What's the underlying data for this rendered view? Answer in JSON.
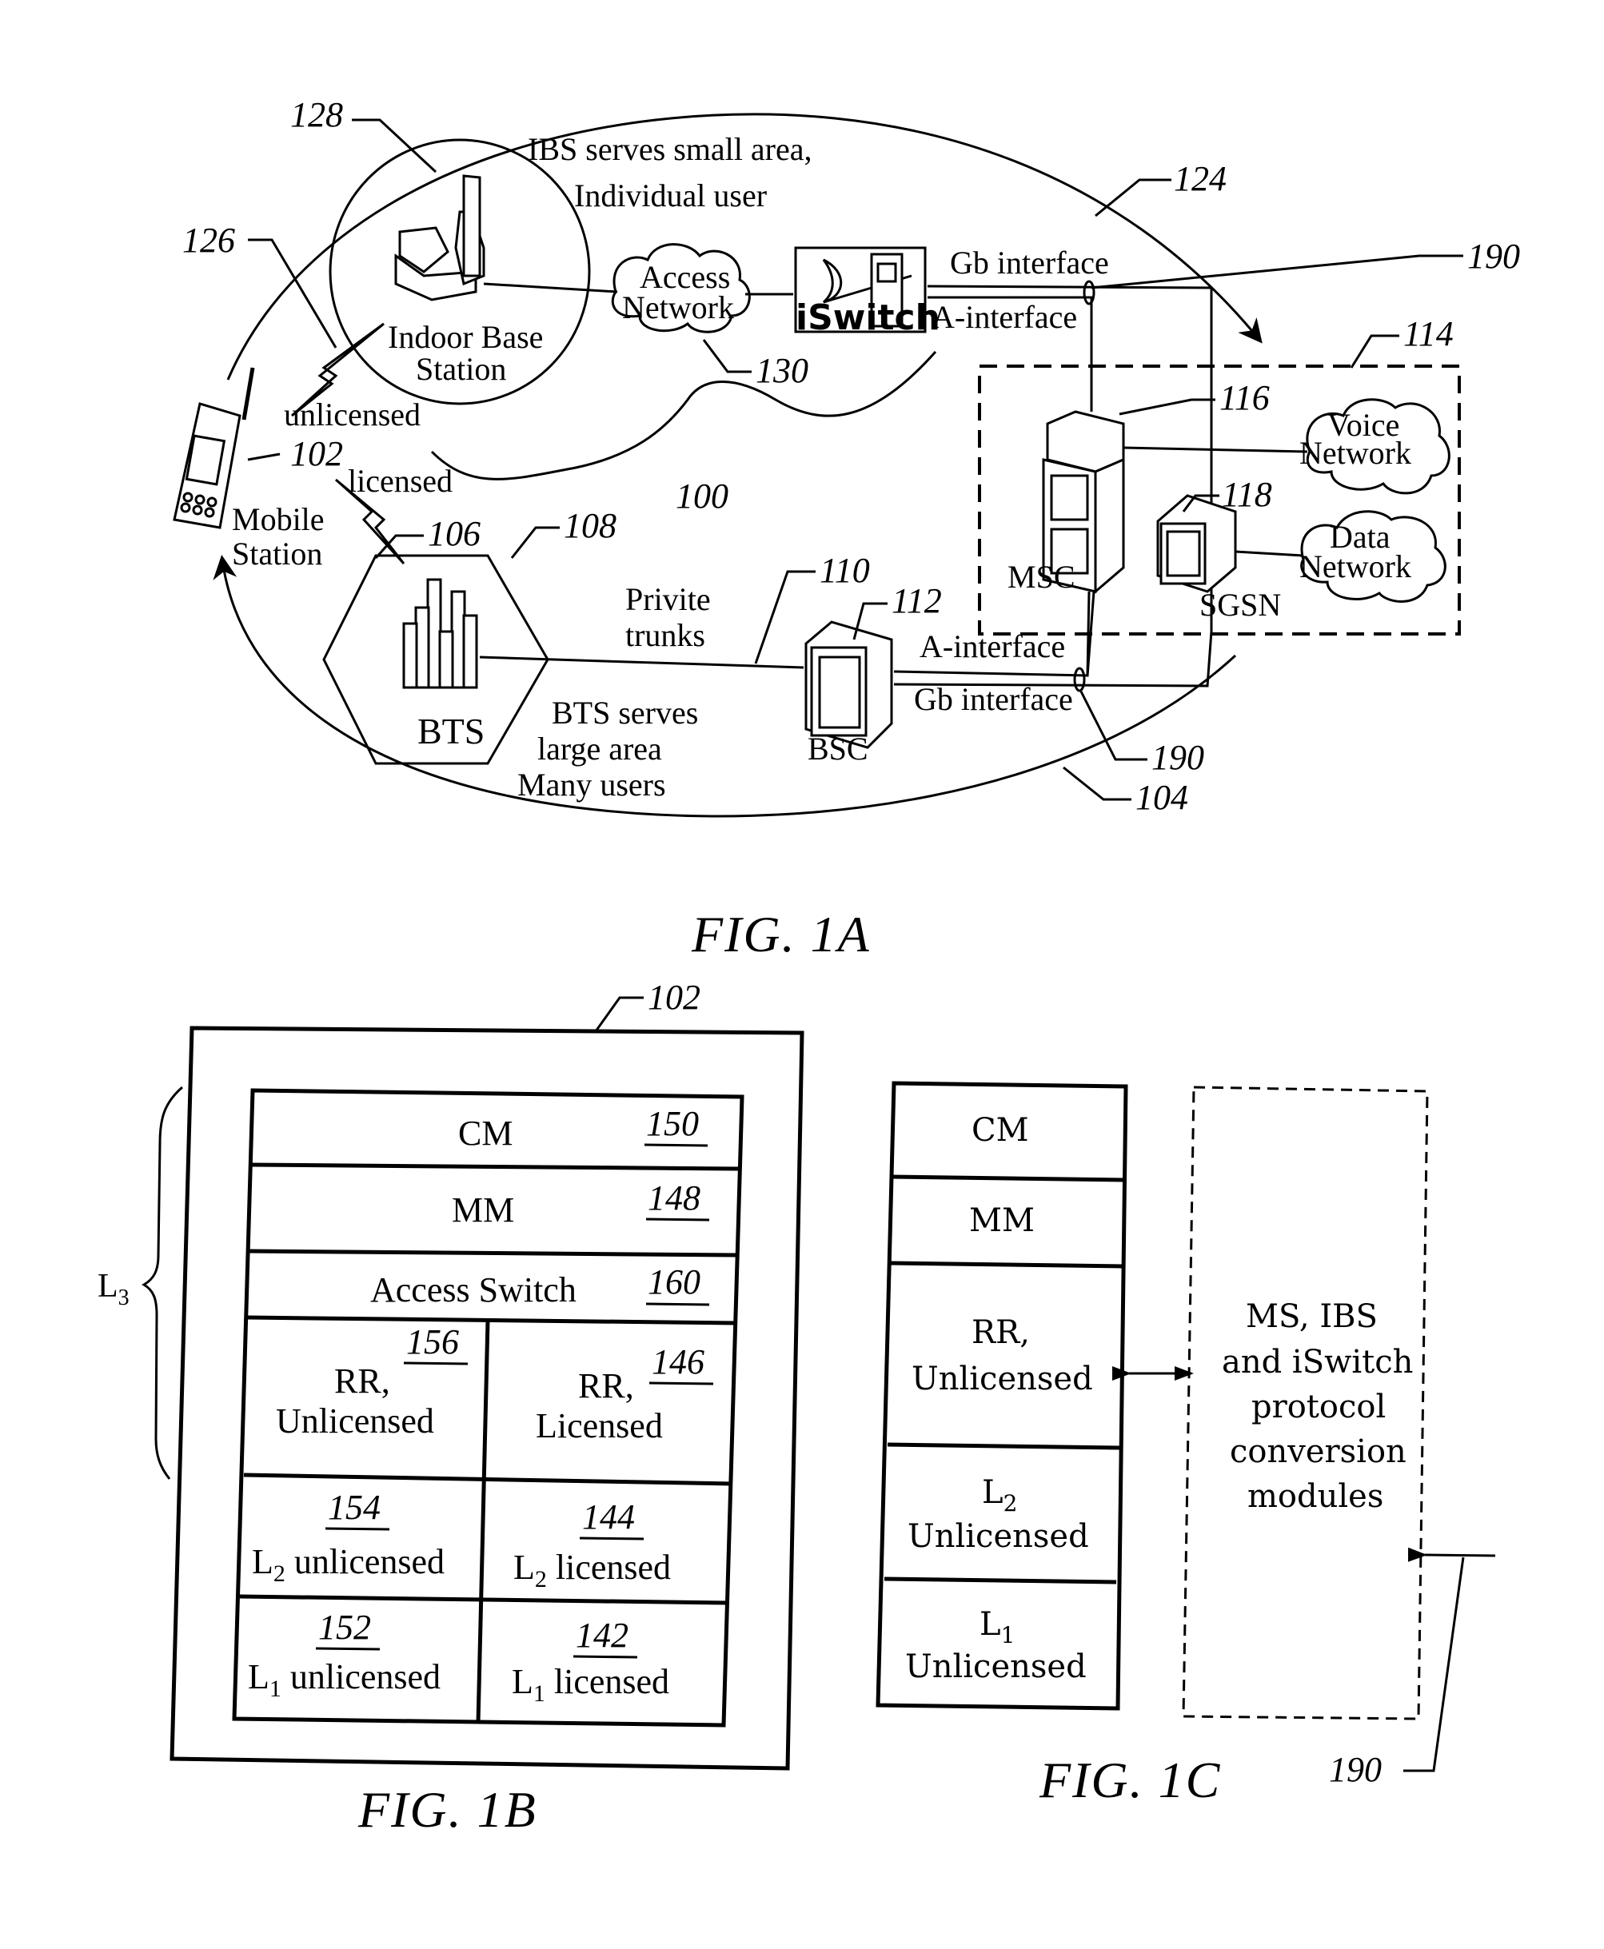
{
  "figures": {
    "fig1a": {
      "caption": "FIG. 1A",
      "notes": {
        "ibs_line1": "IBS serves small area,",
        "ibs_line2": "Individual user",
        "bts_line1": "BTS serves",
        "bts_line2": "large area",
        "bts_line3": "Many users",
        "trunks_line1": "Privite",
        "trunks_line2": "trunks"
      },
      "nodes": {
        "ibs_line1": "Indoor Base",
        "ibs_line2": "Station",
        "access_net_line1": "Access",
        "access_net_line2": "Network",
        "iswitch": "iSwitch",
        "mobile_line1": "Mobile",
        "mobile_line2": "Station",
        "bts": "BTS",
        "bsc": "BSC",
        "msc": "MSC",
        "sgsn": "SGSN",
        "voice_line1": "Voice",
        "voice_line2": "Network",
        "data_line1": "Data",
        "data_line2": "Network"
      },
      "links": {
        "unlicensed": "unlicensed",
        "licensed": "licensed",
        "gb_top": "Gb interface",
        "a_top": "A-interface",
        "a_bottom": "A-interface",
        "gb_bottom": "Gb interface"
      },
      "refs": {
        "r128": "128",
        "r126": "126",
        "r124": "124",
        "r190a": "190",
        "r114": "114",
        "r130": "130",
        "r116": "116",
        "r102": "102",
        "r100": "100",
        "r118": "118",
        "r106": "106",
        "r108": "108",
        "r110": "110",
        "r112": "112",
        "r190b": "190",
        "r104": "104"
      }
    },
    "fig1b": {
      "caption": "FIG. 1B",
      "ref_outer": "102",
      "bracket_label": "L",
      "bracket_sub": "3",
      "rows": {
        "cm": {
          "label": "CM",
          "ref": "150"
        },
        "mm": {
          "label": "MM",
          "ref": "148"
        },
        "access": {
          "label": "Access Switch",
          "ref": "160"
        }
      },
      "cells": {
        "rr_unl": {
          "line1": "RR,",
          "line2": "Unlicensed",
          "ref": "156"
        },
        "rr_lic": {
          "line1": "RR,",
          "line2": "Licensed",
          "ref": "146"
        },
        "l2_unl": {
          "prefix": "L",
          "sub": "2",
          "suffix": " unlicensed",
          "ref": "154"
        },
        "l2_lic": {
          "prefix": "L",
          "sub": "2",
          "suffix": " licensed",
          "ref": "144"
        },
        "l1_unl": {
          "prefix": "L",
          "sub": "1",
          "suffix": " unlicensed",
          "ref": "152"
        },
        "l1_lic": {
          "prefix": "L",
          "sub": "1",
          "suffix": " licensed",
          "ref": "142"
        }
      }
    },
    "fig1c": {
      "caption": "FIG. 1C",
      "ref": "190",
      "stack": {
        "cm": "CM",
        "mm": "MM",
        "rr_line1": "RR,",
        "rr_line2": "Unlicensed",
        "l2_prefix": "L",
        "l2_sub": "2",
        "l2_line2": "Unlicensed",
        "l1_prefix": "L",
        "l1_sub": "1",
        "l1_line2": "Unlicensed"
      },
      "module": {
        "line1": "MS, IBS",
        "line2": "and iSwitch",
        "line3": "protocol",
        "line4": "conversion",
        "line5": "modules"
      }
    }
  }
}
